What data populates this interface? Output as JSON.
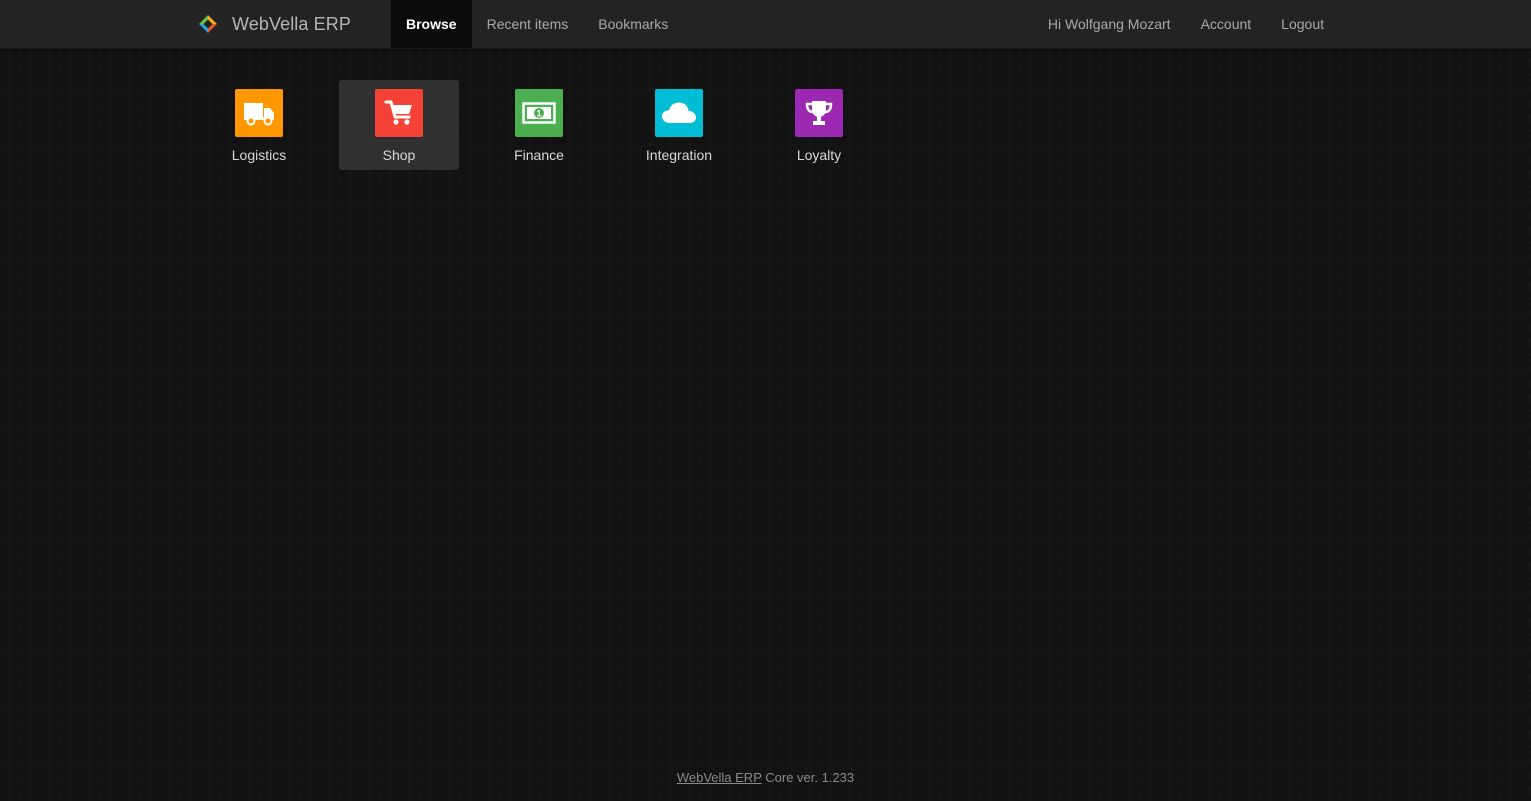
{
  "brand": {
    "name": "WebVella ERP",
    "logo_icon": "webvella-diamond-logo-icon"
  },
  "nav": {
    "left": [
      {
        "label": "Browse",
        "active": true
      },
      {
        "label": "Recent items",
        "active": false
      },
      {
        "label": "Bookmarks",
        "active": false
      }
    ],
    "right": [
      {
        "label": "Hi Wolfgang Mozart"
      },
      {
        "label": "Account"
      },
      {
        "label": "Logout"
      }
    ]
  },
  "apps": [
    {
      "label": "Logistics",
      "icon": "truck-icon",
      "color": "#ff9800",
      "highlighted": false
    },
    {
      "label": "Shop",
      "icon": "shopping-cart-icon",
      "color": "#f44336",
      "highlighted": true
    },
    {
      "label": "Finance",
      "icon": "money-bill-icon",
      "color": "#4caf50",
      "highlighted": false
    },
    {
      "label": "Integration",
      "icon": "cloud-icon",
      "color": "#00bcd4",
      "highlighted": false
    },
    {
      "label": "Loyalty",
      "icon": "trophy-icon",
      "color": "#9c27b0",
      "highlighted": false
    }
  ],
  "footer": {
    "link_text": "WebVella ERP",
    "version_text": " Core ver. 1.233"
  }
}
